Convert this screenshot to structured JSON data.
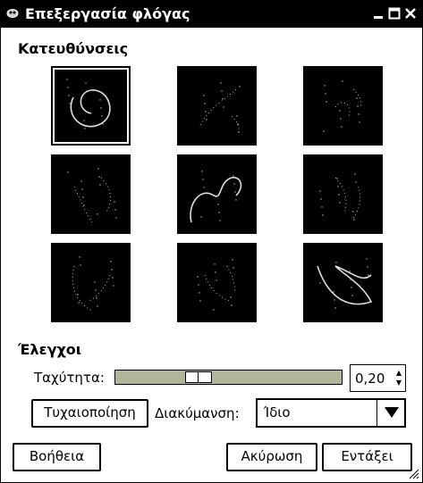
{
  "window": {
    "title": "Επεξεργασία φλόγας",
    "controls": [
      "minimize-icon",
      "maximize-icon",
      "close-icon"
    ]
  },
  "directions": {
    "heading": "Κατευθύνσεις",
    "thumbnails": [
      {
        "name": "center",
        "selected": true
      },
      {
        "name": "variation-1",
        "selected": false
      },
      {
        "name": "variation-2",
        "selected": false
      },
      {
        "name": "variation-3",
        "selected": false
      },
      {
        "name": "variation-4",
        "selected": false
      },
      {
        "name": "variation-5",
        "selected": false
      },
      {
        "name": "variation-6",
        "selected": false
      },
      {
        "name": "variation-7",
        "selected": false
      },
      {
        "name": "variation-8",
        "selected": false
      }
    ]
  },
  "controls": {
    "heading": "Έλεγχοι",
    "speed_label": "Ταχύτητα:",
    "speed_value": "0,20",
    "speed_fraction": 0.35,
    "randomize_label": "Τυχαιοποίηση",
    "variation_label": "Διακύμανση:",
    "variation_value": "Ίδιο"
  },
  "buttons": {
    "help": "Βοήθεια",
    "cancel": "Ακύρωση",
    "ok": "Εντάξει"
  },
  "colors": {
    "titlebar": "#000000",
    "slider_trough": "#b3b598",
    "thumb_bg": "#000000"
  }
}
